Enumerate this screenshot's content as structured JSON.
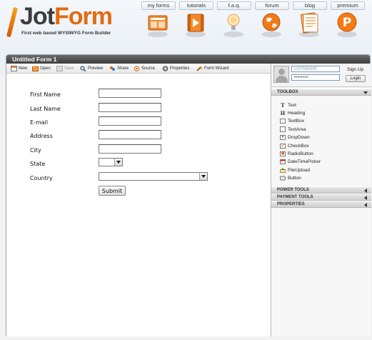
{
  "app": {
    "logo_main_1": "Jot",
    "logo_main_2": "Form",
    "tagline": "First web based WYSIWYG Form Builder"
  },
  "nav": {
    "tabs": [
      "my forms",
      "tutorials",
      "f.a.q.",
      "forum",
      "blog",
      "premium"
    ]
  },
  "window": {
    "title": "Untitled Form 1"
  },
  "toolbar": {
    "new": "New",
    "open": "Open",
    "save": "Save",
    "preview": "Preview",
    "share": "Share",
    "source": "Source",
    "properties": "Properties",
    "wizard": "Form Wizard"
  },
  "form": {
    "first_name": "First Name",
    "last_name": "Last Name",
    "email": "E-mail",
    "address": "Address",
    "city": "City",
    "state": "State",
    "country": "Country",
    "submit": "Submit"
  },
  "login": {
    "username_placeholder": "USERNAME",
    "password_value": "••••••••",
    "signup": "Sign Up",
    "login_button": "Login"
  },
  "panel": {
    "toolbox": "TOOLBOX",
    "tools": [
      "Text",
      "Heading",
      "TextBox",
      "TextArea",
      "DropDown",
      "CheckBox",
      "RadioButton",
      "DateTimePicker",
      "FileUpload",
      "Button"
    ],
    "power_tools": "POWER TOOLS",
    "payment_tools": "PAYMENT TOOLS",
    "properties": "PROPERTIES"
  },
  "colors": {
    "brand_orange": "#e46b0e",
    "title_bar": "#4a4a4a"
  }
}
